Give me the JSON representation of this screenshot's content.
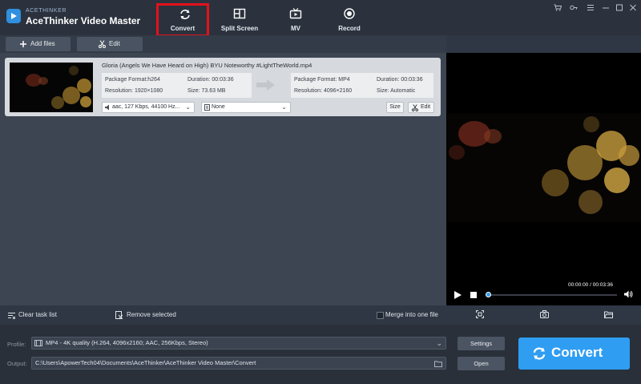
{
  "app": {
    "brand_small": "ACETHINKER",
    "title": "AceThinker Video Master"
  },
  "nav": {
    "tabs": [
      {
        "label": "Convert",
        "icon": "refresh-icon",
        "active": true
      },
      {
        "label": "Split Screen",
        "icon": "split-screen-icon"
      },
      {
        "label": "MV",
        "icon": "tv-icon"
      },
      {
        "label": "Record",
        "icon": "record-icon"
      }
    ]
  },
  "window_controls": [
    "cart-icon",
    "key-icon",
    "menu-icon",
    "minimize-icon",
    "maximize-icon",
    "close-icon"
  ],
  "toolbar": {
    "add_files": "Add files",
    "edit": "Edit"
  },
  "task": {
    "filename": "Gloria (Angels We Have Heard on High)  BYU Noteworthy  #LightTheWorld.mp4",
    "source": {
      "package_format": "Package Format:h264",
      "duration": "Duration: 00:03:36",
      "resolution": "Resolution: 1920×1080",
      "size": "Size: 73.63 MB"
    },
    "output": {
      "package_format": "Package Format: MP4",
      "duration": "Duration: 00:03:36",
      "resolution": "Resolution: 4096×2160",
      "size": "Size: Automatic"
    },
    "audio_track": "aac, 127 Kbps, 44100 Hz...",
    "subtitle": "None",
    "size_button": "Size",
    "edit_button": "Edit"
  },
  "player": {
    "timecode": "00:00:00 / 00:03:36",
    "progress": 0.0
  },
  "bottom_bar": {
    "clear_task_list": "Clear task list",
    "remove_selected": "Remove selected",
    "merge_into_one_file": "Merge into one file",
    "merge_checked": false
  },
  "footer": {
    "profile_label": "Profile:",
    "profile_value": "MP4 - 4K quality (H.264, 4096x2160; AAC, 256Kbps, Stereo)",
    "output_label": "Output:",
    "output_path": "C:\\Users\\ApowerTech04\\Documents\\AceThinker\\AceThinker Video Master\\Convert",
    "settings_button": "Settings",
    "open_button": "Open",
    "convert_button": "Convert"
  },
  "colors": {
    "accent": "#2f9df2",
    "highlight_box": "#e3121c",
    "background": "#2f3744"
  }
}
